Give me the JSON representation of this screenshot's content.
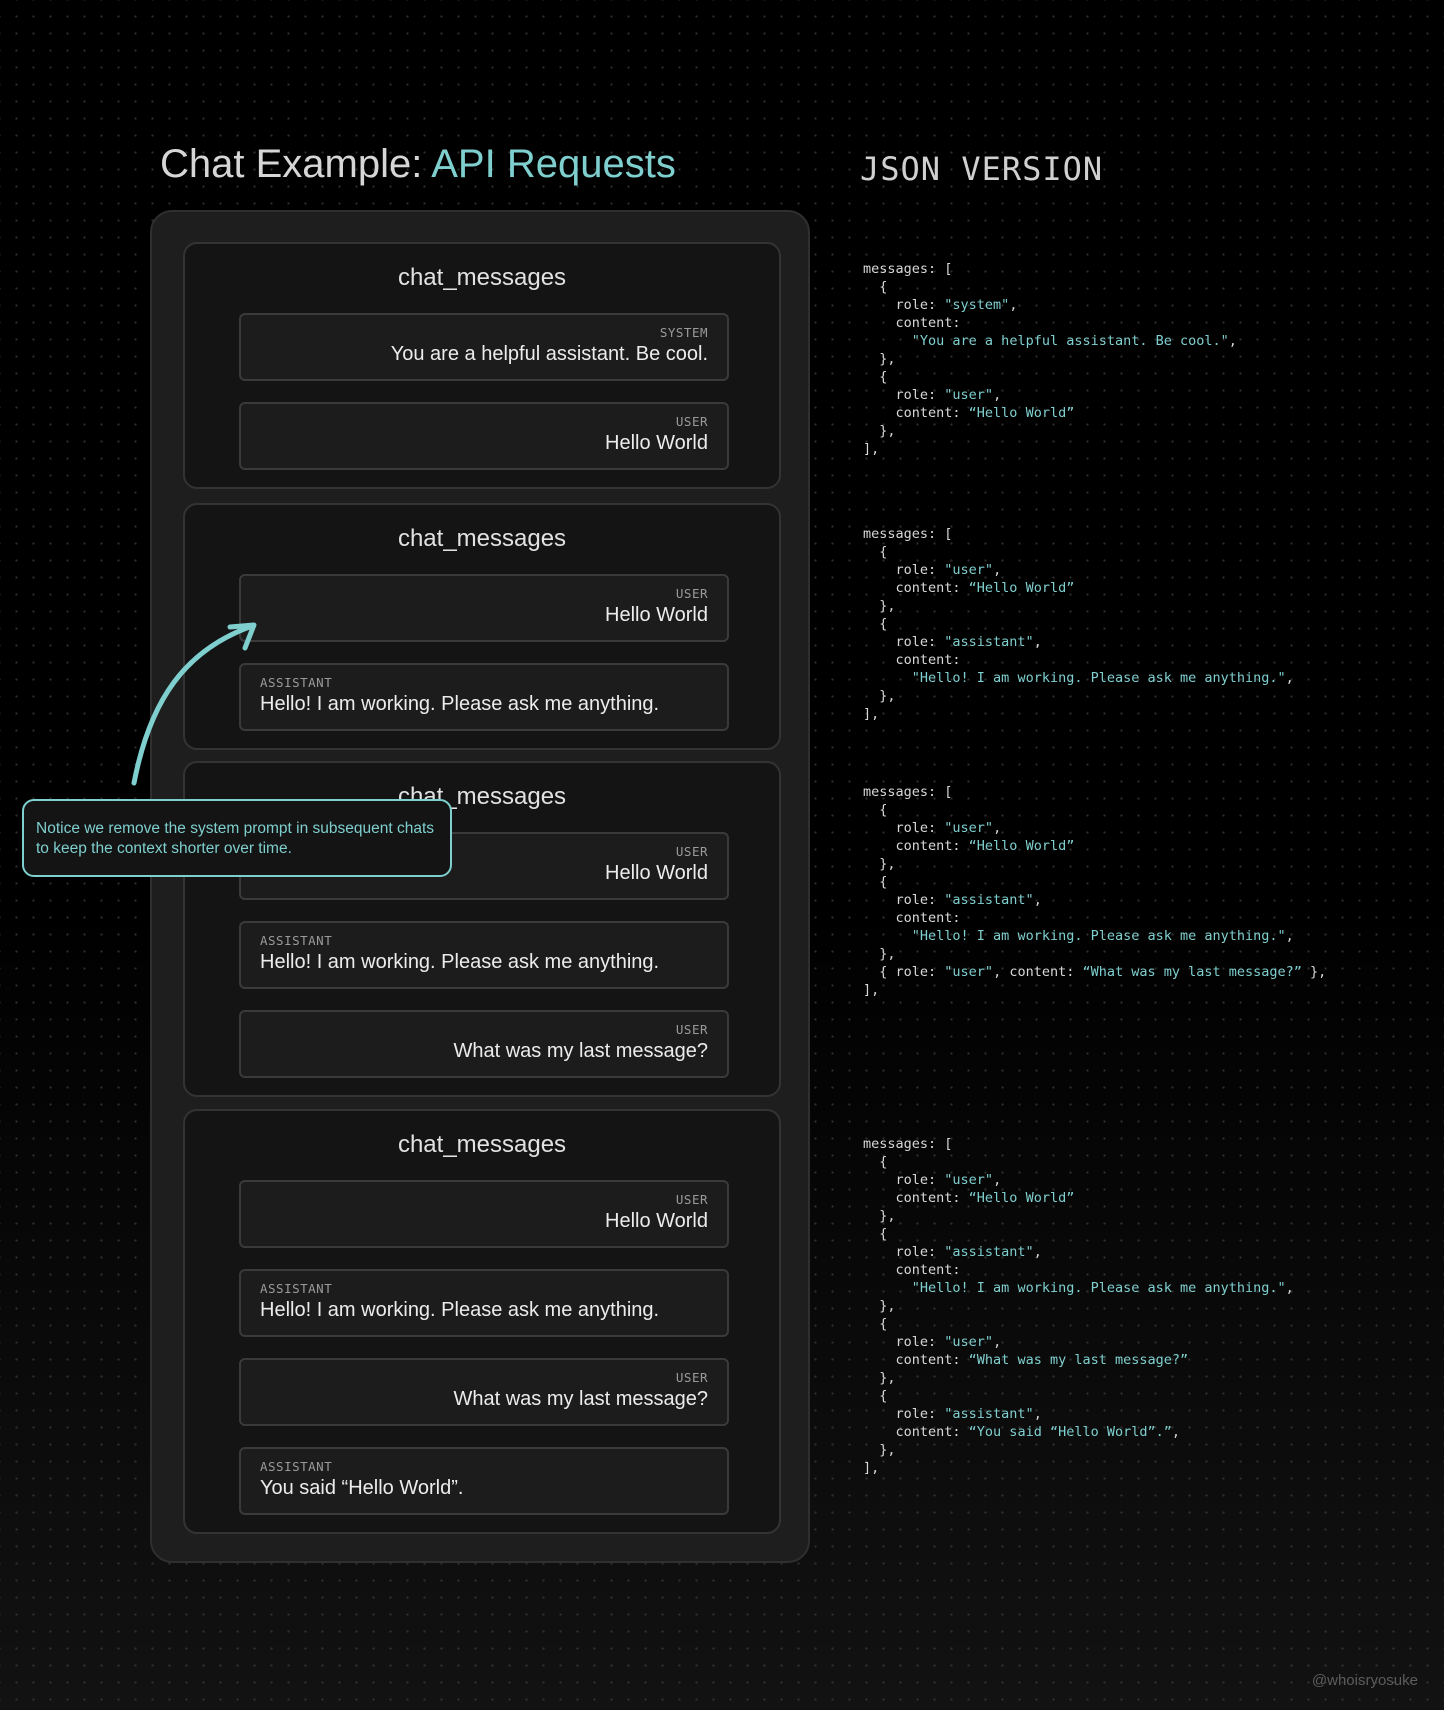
{
  "title": {
    "prefix": "Chat Example: ",
    "accent": "API Requests"
  },
  "json_title": "JSON VERSION",
  "colors": {
    "accent": "#7fcfcf",
    "panel": "#1e1e1e",
    "card": "#141414",
    "message": "#1c1c1c"
  },
  "cards": [
    {
      "title": "chat_messages",
      "messages": [
        {
          "role": "SYSTEM",
          "text": "You are a helpful assistant. Be cool.",
          "align": "right"
        },
        {
          "role": "USER",
          "text": "Hello World",
          "align": "right"
        }
      ]
    },
    {
      "title": "chat_messages",
      "messages": [
        {
          "role": "USER",
          "text": "Hello World",
          "align": "right"
        },
        {
          "role": "ASSISTANT",
          "text": "Hello! I am working. Please ask me anything.",
          "align": "left"
        }
      ]
    },
    {
      "title": "chat_messages",
      "messages": [
        {
          "role": "USER",
          "text": "Hello World",
          "align": "right"
        },
        {
          "role": "ASSISTANT",
          "text": "Hello! I am working. Please ask me anything.",
          "align": "left"
        },
        {
          "role": "USER",
          "text": "What was my last message?",
          "align": "right"
        }
      ]
    },
    {
      "title": "chat_messages",
      "messages": [
        {
          "role": "USER",
          "text": "Hello World",
          "align": "right"
        },
        {
          "role": "ASSISTANT",
          "text": "Hello! I am working. Please ask me anything.",
          "align": "left"
        },
        {
          "role": "USER",
          "text": "What was my last message?",
          "align": "right"
        },
        {
          "role": "ASSISTANT",
          "text": "You said “Hello World”.",
          "align": "left"
        }
      ]
    }
  ],
  "json_blocks": [
    [
      [
        [
          "messages: [",
          ""
        ]
      ],
      [
        [
          "  {",
          ""
        ]
      ],
      [
        [
          "    role: ",
          ""
        ],
        [
          "\"system\"",
          "s"
        ],
        [
          ",",
          ""
        ]
      ],
      [
        [
          "    content:",
          ""
        ]
      ],
      [
        [
          "      ",
          ""
        ],
        [
          "\"You are a helpful assistant. Be cool.\"",
          "s"
        ],
        [
          ",",
          ""
        ]
      ],
      [
        [
          "  },",
          ""
        ]
      ],
      [
        [
          "  {",
          ""
        ]
      ],
      [
        [
          "    role: ",
          ""
        ],
        [
          "\"user\"",
          "s"
        ],
        [
          ",",
          ""
        ]
      ],
      [
        [
          "    content: ",
          ""
        ],
        [
          "“Hello World”",
          "s"
        ]
      ],
      [
        [
          "  },",
          ""
        ]
      ],
      [
        [
          "],",
          ""
        ]
      ]
    ],
    [
      [
        [
          "messages: [",
          ""
        ]
      ],
      [
        [
          "  {",
          ""
        ]
      ],
      [
        [
          "    role: ",
          ""
        ],
        [
          "\"user\"",
          "s"
        ],
        [
          ",",
          ""
        ]
      ],
      [
        [
          "    content: ",
          ""
        ],
        [
          "“Hello World”",
          "s"
        ]
      ],
      [
        [
          "  },",
          ""
        ]
      ],
      [
        [
          "  {",
          ""
        ]
      ],
      [
        [
          "    role: ",
          ""
        ],
        [
          "\"assistant\"",
          "s"
        ],
        [
          ",",
          ""
        ]
      ],
      [
        [
          "    content:",
          ""
        ]
      ],
      [
        [
          "      ",
          ""
        ],
        [
          "\"Hello! I am working. Please ask me anything.\"",
          "s"
        ],
        [
          ",",
          ""
        ]
      ],
      [
        [
          "  },",
          ""
        ]
      ],
      [
        [
          "],",
          ""
        ]
      ]
    ],
    [
      [
        [
          "messages: [",
          ""
        ]
      ],
      [
        [
          "  {",
          ""
        ]
      ],
      [
        [
          "    role: ",
          ""
        ],
        [
          "\"user\"",
          "s"
        ],
        [
          ",",
          ""
        ]
      ],
      [
        [
          "    content: ",
          ""
        ],
        [
          "“Hello World”",
          "s"
        ]
      ],
      [
        [
          "  },",
          ""
        ]
      ],
      [
        [
          "  {",
          ""
        ]
      ],
      [
        [
          "    role: ",
          ""
        ],
        [
          "\"assistant\"",
          "s"
        ],
        [
          ",",
          ""
        ]
      ],
      [
        [
          "    content:",
          ""
        ]
      ],
      [
        [
          "      ",
          ""
        ],
        [
          "\"Hello! I am working. Please ask me anything.\"",
          "s"
        ],
        [
          ",",
          ""
        ]
      ],
      [
        [
          "  },",
          ""
        ]
      ],
      [
        [
          "  { role: ",
          ""
        ],
        [
          "\"user\"",
          "s"
        ],
        [
          ", content: ",
          ""
        ],
        [
          "“What was my last message?”",
          "s"
        ],
        [
          " },",
          ""
        ]
      ],
      [
        [
          "],",
          ""
        ]
      ]
    ],
    [
      [
        [
          "messages: [",
          ""
        ]
      ],
      [
        [
          "  {",
          ""
        ]
      ],
      [
        [
          "    role: ",
          ""
        ],
        [
          "\"user\"",
          "s"
        ],
        [
          ",",
          ""
        ]
      ],
      [
        [
          "    content: ",
          ""
        ],
        [
          "“Hello World”",
          "s"
        ]
      ],
      [
        [
          "  },",
          ""
        ]
      ],
      [
        [
          "  {",
          ""
        ]
      ],
      [
        [
          "    role: ",
          ""
        ],
        [
          "\"assistant\"",
          "s"
        ],
        [
          ",",
          ""
        ]
      ],
      [
        [
          "    content:",
          ""
        ]
      ],
      [
        [
          "      ",
          ""
        ],
        [
          "\"Hello! I am working. Please ask me anything.\"",
          "s"
        ],
        [
          ",",
          ""
        ]
      ],
      [
        [
          "  },",
          ""
        ]
      ],
      [
        [
          "  {",
          ""
        ]
      ],
      [
        [
          "    role: ",
          ""
        ],
        [
          "\"user\"",
          "s"
        ],
        [
          ",",
          ""
        ]
      ],
      [
        [
          "    content: ",
          ""
        ],
        [
          "“What was my last message?”",
          "s"
        ]
      ],
      [
        [
          "  },",
          ""
        ]
      ],
      [
        [
          "  {",
          ""
        ]
      ],
      [
        [
          "    role: ",
          ""
        ],
        [
          "\"assistant\"",
          "s"
        ],
        [
          ",",
          ""
        ]
      ],
      [
        [
          "    content: ",
          ""
        ],
        [
          "“You said “Hello World”.”",
          "s"
        ],
        [
          ",",
          ""
        ]
      ],
      [
        [
          "  },",
          ""
        ]
      ],
      [
        [
          "],",
          ""
        ]
      ]
    ]
  ],
  "callout": "Notice we remove the system prompt in subsequent chats to keep the context shorter over time.",
  "watermark": "@whoisryosuke"
}
